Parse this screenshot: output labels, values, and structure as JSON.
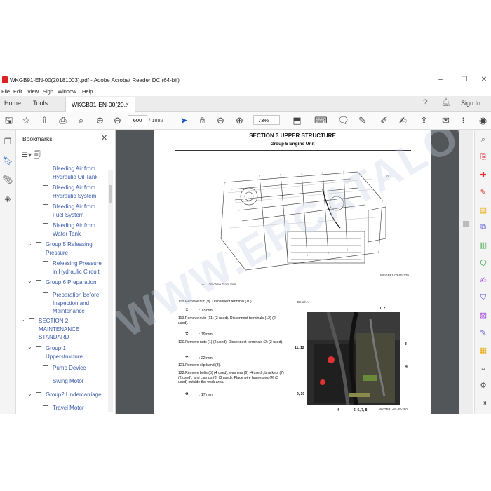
{
  "window": {
    "title": "WKGB91-EN-00(20181003).pdf - Adobe Acrobat Reader DC (64-bit)",
    "minimize": "–",
    "maximize": "☐",
    "close": "✕"
  },
  "menu": [
    "File",
    "Edit",
    "View",
    "Sign",
    "Window",
    "Help"
  ],
  "tabs": {
    "home": "Home",
    "tools": "Tools",
    "document": "WKGB91-EN-00(20...",
    "close": "×"
  },
  "toolbar": {
    "page_current": "600",
    "page_total": "/ 1882",
    "zoom": "73%",
    "signin": "Sign In"
  },
  "bookmarks": {
    "header": "Bookmarks",
    "items": [
      {
        "label": "Bleeding Air from Hydraulic Oil Tank",
        "level": 3
      },
      {
        "label": "Bleeding Air from Hydraulic System",
        "level": 3
      },
      {
        "label": "Bleeding Air from Fuel System",
        "level": 3
      },
      {
        "label": "Bleeding Air from Water Tank",
        "level": 3
      },
      {
        "label": "Group 5 Releasing Pressure",
        "level": 2
      },
      {
        "label": "Releasing Pressure in Hydraulic Circuit",
        "level": 3
      },
      {
        "label": "Group 6 Preparation",
        "level": 2
      },
      {
        "label": "Preparation before Inspection and Maintenance",
        "level": 3
      },
      {
        "label": "SECTION 2 MAINTENANCE STANDARD",
        "level": 1
      },
      {
        "label": "Group 1 Upperstructure",
        "level": 2
      },
      {
        "label": "Pump Device",
        "level": 3
      },
      {
        "label": "Swing Motor",
        "level": 3
      },
      {
        "label": "Group2 Undercarriage",
        "level": 2
      },
      {
        "label": "Travel Motor",
        "level": 3
      }
    ]
  },
  "page": {
    "section": "SECTION 3 UPPER STRUCTURE",
    "group": "Group 5 Engine Unit",
    "fig1_ref": "WKGB91-03-05-279",
    "fig1_caption": "Machine Front Side",
    "fig1_detail": "A",
    "fig2_ref": "WKGB91-03-05-280",
    "detail_label": "Detail A",
    "steps": [
      {
        "text": "118.Remove nut (9). Disconnect terminal (10).",
        "tool": ": 13 mm"
      },
      {
        "text": "119.Remove nuts (11) (2 used). Disconnect terminals (12) (2 used).",
        "tool": ": 19 mm"
      },
      {
        "text": "120.Remove nuts (1) (2 used). Disconnect terminals (2) (2 used).",
        "tool": ": 22 mm"
      },
      {
        "text": "121.Remove clip band (3).",
        "tool": ""
      },
      {
        "text": "122.Remove bolts (5) (4 used), washers (6) (4 used), brackets (7) (2 used), and clamps (8) (3 used). Place wire harnesses (4) (3 used) outside the work area.",
        "tool": ": 17 mm"
      }
    ],
    "callouts": [
      "1, 2",
      "3",
      "11, 12",
      "4",
      "9, 10",
      "4",
      "5, 6, 7, 8"
    ]
  },
  "watermark": "WWW.EPCATALOG.COM"
}
